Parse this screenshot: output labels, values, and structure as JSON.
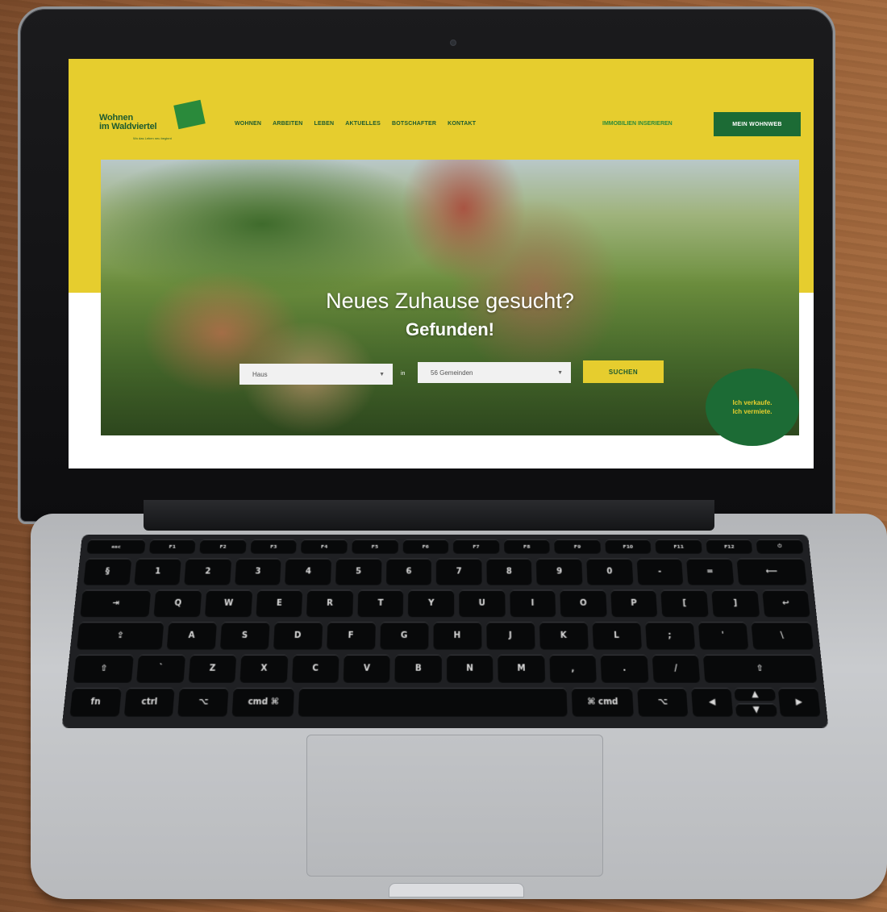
{
  "header": {
    "logo": {
      "line1": "Wohnen",
      "line2": "im Waldviertel",
      "slogan": "Wo das Leben neu beginnt"
    },
    "nav": [
      "WOHNEN",
      "ARBEITEN",
      "LEBEN",
      "AKTUELLES",
      "BOTSCHAFTER",
      "KONTAKT"
    ],
    "cta_link": "IMMOBILIEN INSERIEREN",
    "account_button": "MEIN WOHNWEB"
  },
  "hero": {
    "title": "Neues Zuhause gesucht?",
    "subtitle": "Gefunden!",
    "search": {
      "type_value": "Haus",
      "in_label": "in",
      "location_value": "56 Gemeinden",
      "submit_label": "SUCHEN"
    }
  },
  "seller_cta": {
    "line1": "Ich verkaufe.",
    "line2": "Ich vermiete."
  },
  "colors": {
    "brand_yellow": "#e6cd2e",
    "brand_green": "#1c6b35",
    "accent_green": "#2a8a3b"
  },
  "keyboard": {
    "fn_row": [
      "esc",
      "F1",
      "F2",
      "F3",
      "F4",
      "F5",
      "F6",
      "F7",
      "F8",
      "F9",
      "F10",
      "F11",
      "F12",
      "⏻"
    ],
    "number_row": [
      "§",
      "1",
      "2",
      "3",
      "4",
      "5",
      "6",
      "7",
      "8",
      "9",
      "0",
      "-",
      "=",
      "⟵"
    ],
    "top_row": [
      "⇥",
      "Q",
      "W",
      "E",
      "R",
      "T",
      "Y",
      "U",
      "I",
      "O",
      "P",
      "[",
      "]",
      "↩"
    ],
    "home_row": [
      "⇪",
      "A",
      "S",
      "D",
      "F",
      "G",
      "H",
      "J",
      "K",
      "L",
      ";",
      "'",
      "\\"
    ],
    "bottom_row": [
      "⇧",
      "`",
      "Z",
      "X",
      "C",
      "V",
      "B",
      "N",
      "M",
      ",",
      ".",
      "/",
      "⇧"
    ],
    "modifier_row": [
      "fn",
      "ctrl",
      "⌥",
      "cmd ⌘",
      "",
      "⌘ cmd",
      "⌥"
    ],
    "arrows": [
      "◀",
      "▲",
      "▼",
      "▶"
    ]
  }
}
